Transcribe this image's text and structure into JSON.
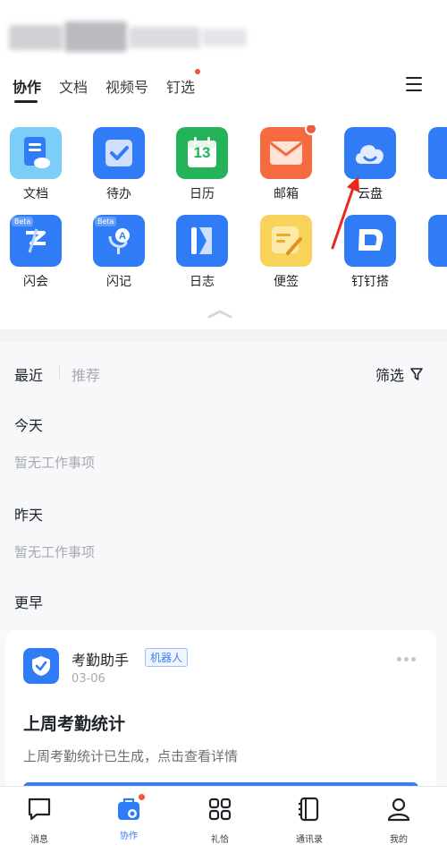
{
  "top_tabs": [
    {
      "label": "协作",
      "active": true
    },
    {
      "label": "文档"
    },
    {
      "label": "视频号"
    },
    {
      "label": "钉选",
      "dot": true
    }
  ],
  "apps": [
    {
      "label": "文档",
      "icon": "doc-icon",
      "color": "#5fc3f6"
    },
    {
      "label": "待办",
      "icon": "todo-icon",
      "color": "#2f7cf6"
    },
    {
      "label": "日历",
      "icon": "calendar-icon",
      "color": "#25b35a",
      "day": "13"
    },
    {
      "label": "邮箱",
      "icon": "mail-icon",
      "color": "#f56a3e",
      "dot": true
    },
    {
      "label": "云盘",
      "icon": "cloud-icon",
      "color": "#2f7cf6"
    },
    {
      "label": "闪会",
      "icon": "flash-meeting-icon",
      "color": "#2f7cf6",
      "badge": "Beta"
    },
    {
      "label": "闪记",
      "icon": "flash-note-icon",
      "color": "#2f7cf6",
      "badge": "Beta"
    },
    {
      "label": "日志",
      "icon": "log-icon",
      "color": "#2f7cf6"
    },
    {
      "label": "便签",
      "icon": "sticky-note-icon",
      "color": "#f6c540"
    },
    {
      "label": "钉钉搭",
      "icon": "dingda-icon",
      "color": "#2f7cf6"
    }
  ],
  "recent": {
    "tab_recent": "最近",
    "tab_recommend": "推荐",
    "filter_label": "筛选"
  },
  "groups": {
    "today": "今天",
    "today_empty": "暂无工作事项",
    "yesterday": "昨天",
    "yesterday_empty": "暂无工作事项",
    "earlier": "更早"
  },
  "card": {
    "name": "考勤助手",
    "tag": "机器人",
    "date": "03-06",
    "title": "上周考勤统计",
    "desc": "上周考勤统计已生成，点击查看详情"
  },
  "bottom_nav": [
    {
      "label": "消息",
      "icon": "message-icon"
    },
    {
      "label": "协作",
      "icon": "collaboration-icon",
      "active": true,
      "dot": true
    },
    {
      "label": "礼恰",
      "icon": "grid-icon"
    },
    {
      "label": "通讯录",
      "icon": "contacts-icon"
    },
    {
      "label": "我的",
      "icon": "profile-icon"
    }
  ],
  "colors": {
    "accent": "#2f7cf6",
    "dot": "#f0583c",
    "arrow": "#e8291c"
  }
}
